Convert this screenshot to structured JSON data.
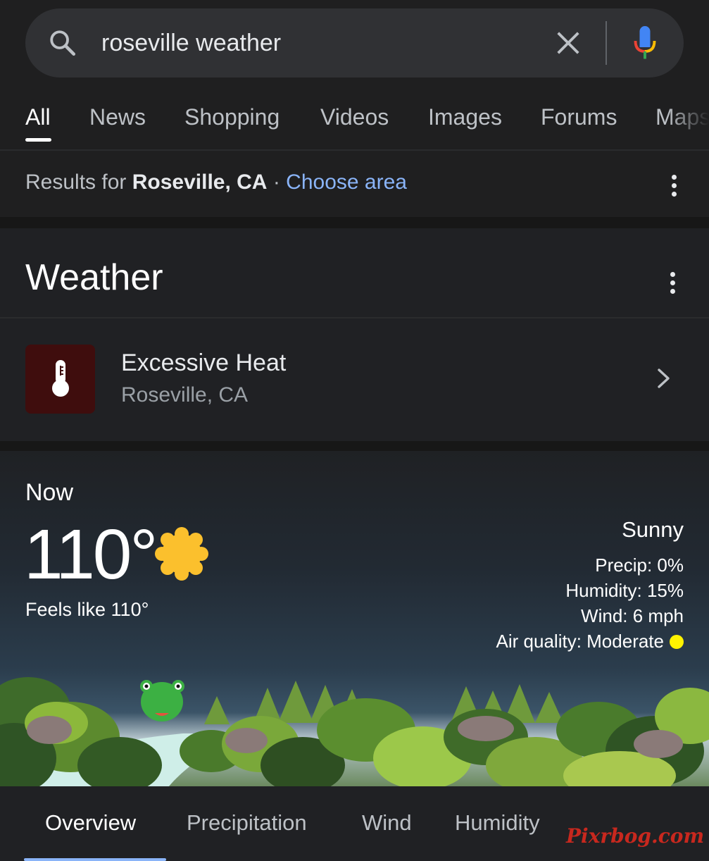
{
  "search": {
    "query": "roseville weather",
    "icons": {
      "search": "search-icon",
      "clear": "close-icon",
      "voice": "mic-icon"
    }
  },
  "tabs": [
    {
      "label": "All",
      "active": true
    },
    {
      "label": "News"
    },
    {
      "label": "Shopping"
    },
    {
      "label": "Videos"
    },
    {
      "label": "Images"
    },
    {
      "label": "Forums"
    },
    {
      "label": "Maps"
    }
  ],
  "results_for": {
    "prefix": "Results for",
    "location": "Roseville, CA",
    "separator": "·",
    "link": "Choose area"
  },
  "weather": {
    "title": "Weather",
    "alert": {
      "title": "Excessive Heat",
      "location": "Roseville, CA",
      "icon": "thermometer-icon",
      "icon_bg": "#3f0d0d"
    },
    "now": {
      "label": "Now",
      "temperature": "110°",
      "feels_like": "Feels like 110°",
      "condition": "Sunny",
      "precip": "Precip: 0%",
      "humidity": "Humidity: 15%",
      "wind": "Wind: 6 mph",
      "air_quality": "Air quality: Moderate",
      "air_quality_color": "#fff200",
      "condition_icon": "sun-icon"
    },
    "tabs": [
      {
        "label": "Overview",
        "active": true
      },
      {
        "label": "Precipitation"
      },
      {
        "label": "Wind"
      },
      {
        "label": "Humidity"
      }
    ]
  },
  "watermark": "Pixrbog.com",
  "colors": {
    "background": "#1f1f20",
    "link": "#8ab4f8",
    "active_underline": "#8ab4f8"
  }
}
